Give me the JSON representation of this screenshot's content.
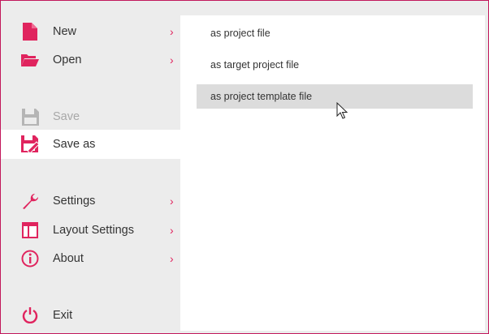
{
  "menu": {
    "items": [
      {
        "label": "New",
        "icon": "new-file-icon",
        "submenu": true
      },
      {
        "label": "Open",
        "icon": "open-folder-icon",
        "submenu": true
      },
      {
        "label": "Save",
        "icon": "save-icon",
        "disabled": true
      },
      {
        "label": "Save as",
        "icon": "save-as-icon",
        "selected": true
      },
      {
        "label": "Settings",
        "icon": "wrench-icon",
        "submenu": true
      },
      {
        "label": "Layout Settings",
        "icon": "layout-icon",
        "submenu": true
      },
      {
        "label": "About",
        "icon": "info-icon",
        "submenu": true
      },
      {
        "label": "Exit",
        "icon": "power-icon"
      }
    ],
    "chevron": "›"
  },
  "submenu": {
    "items": [
      {
        "label": "as project file"
      },
      {
        "label": "as target project file"
      },
      {
        "label": "as project template file",
        "hovered": true
      }
    ]
  },
  "colors": {
    "accent": "#e0245e",
    "disabled": "#a8a8a8",
    "hover": "#dcdcdc",
    "border": "#c2185b"
  }
}
